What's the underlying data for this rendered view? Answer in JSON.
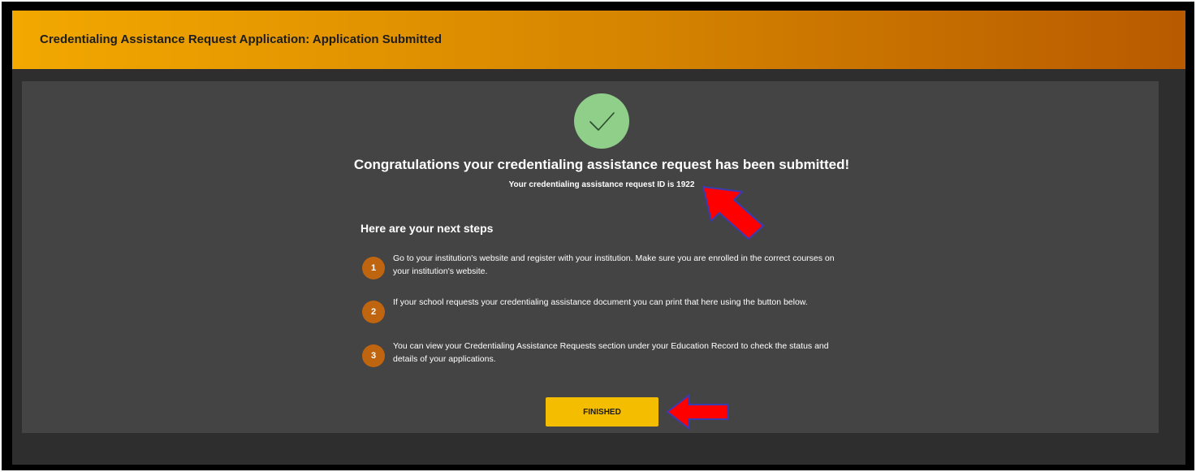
{
  "header": {
    "title": "Credentialing Assistance Request Application: Application Submitted"
  },
  "confirmation": {
    "icon": "check-icon",
    "icon_color": "#8fcf8a",
    "headline": "Congratulations your credentialing assistance request has been submitted!",
    "request_id_text": "Your credentialing assistance request ID is 1922"
  },
  "next_steps": {
    "heading": "Here are your next steps",
    "steps": [
      {
        "number": "1",
        "text": "Go to your institution's website and register with your institution. Make sure you are enrolled in the correct courses on your institution's website."
      },
      {
        "number": "2",
        "text": "If your school requests your credentialing assistance document you can print that here using the button below."
      },
      {
        "number": "3",
        "text": "You can view your Credentialing Assistance Requests section under your Education Record to check the status and details of your applications."
      }
    ]
  },
  "actions": {
    "finished_label": "FINISHED"
  },
  "annotations": {
    "arrow_color": "#ff0000",
    "arrow_outline": "#3b3bb0"
  },
  "colors": {
    "header_gradient_start": "#f2a800",
    "header_gradient_end": "#b85a00",
    "button": "#f4bd00",
    "step_badge": "#c0650f"
  }
}
